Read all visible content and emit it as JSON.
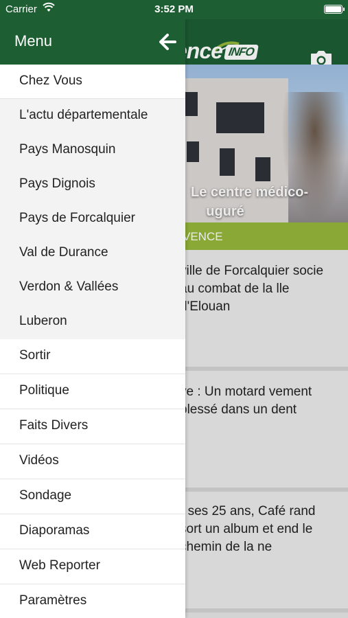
{
  "status_bar": {
    "carrier": "Carrier",
    "time": "3:52 PM"
  },
  "app": {
    "logo_text": "ence",
    "logo_badge": "INFO",
    "hero_title": "Le centre médico-    uguré",
    "category": "VENCE",
    "articles": [
      {
        "text": "ville de Forcalquier socie au combat de la lle d'Elouan"
      },
      {
        "text": "ye : Un motard vement blessé dans un dent"
      },
      {
        "text": "r ses 25 ans, Café rand sort un album et end le chemin de la ne"
      }
    ]
  },
  "drawer": {
    "title": "Menu",
    "items": [
      {
        "label": "Chez Vous"
      },
      {
        "label": "L'actu départementale"
      },
      {
        "label": "Pays Manosquin"
      },
      {
        "label": "Pays Dignois"
      },
      {
        "label": "Pays de Forcalquier"
      },
      {
        "label": "Val de Durance"
      },
      {
        "label": "Verdon & Vallées"
      },
      {
        "label": "Luberon"
      },
      {
        "label": "Sortir"
      },
      {
        "label": "Politique"
      },
      {
        "label": "Faits Divers"
      },
      {
        "label": "Vidéos"
      },
      {
        "label": "Sondage"
      },
      {
        "label": "Diaporamas"
      },
      {
        "label": "Web Reporter"
      },
      {
        "label": "Paramètres"
      }
    ]
  },
  "colors": {
    "header_green": "#1d5e33",
    "category_green": "#95b73b"
  }
}
